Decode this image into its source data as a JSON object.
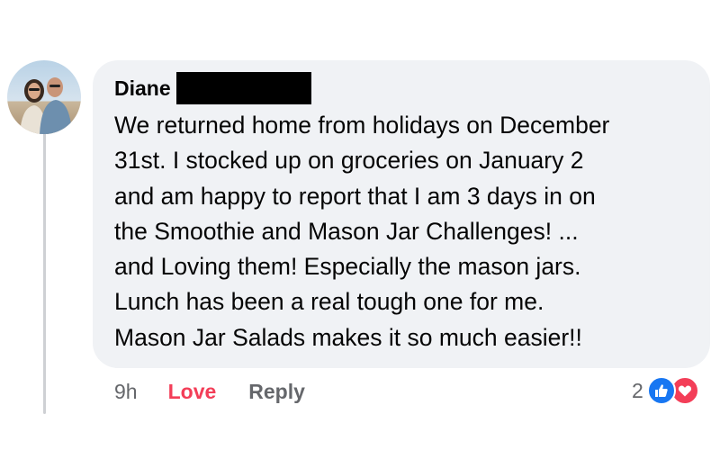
{
  "comment": {
    "author": "Diane",
    "text_lines": [
      "We returned home from holidays on December",
      "31st.  I stocked up on groceries on January 2",
      "and am happy to report that I am 3 days in on",
      "the Smoothie and Mason Jar Challenges! ...",
      "and Loving them!  Especially the mason jars.",
      "Lunch has been a real tough one for me.",
      "Mason Jar Salads makes it so much easier!!"
    ],
    "timestamp": "9h",
    "love_label": "Love",
    "reply_label": "Reply",
    "reaction_count": "2",
    "reaction_icons": [
      "like-icon",
      "love-icon"
    ]
  },
  "colors": {
    "bubble": "#f0f2f5",
    "love": "#f33e58",
    "like": "#1877f2",
    "muted": "#65676b",
    "text": "#050505"
  }
}
